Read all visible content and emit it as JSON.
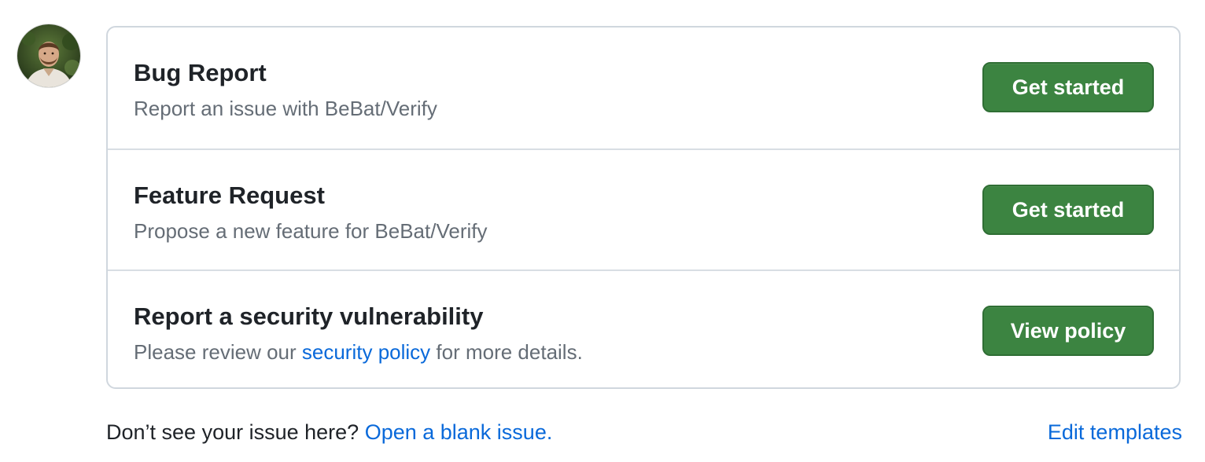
{
  "templates": [
    {
      "title": "Bug Report",
      "description": "Report an issue with BeBat/Verify",
      "button_label": "Get started"
    },
    {
      "title": "Feature Request",
      "description": "Propose a new feature for BeBat/Verify",
      "button_label": "Get started"
    },
    {
      "title": "Report a security vulnerability",
      "description_before": "Please review our ",
      "description_link": "security policy",
      "description_after": " for more details.",
      "button_label": "View policy"
    }
  ],
  "footer": {
    "prompt": "Don’t see your issue here? ",
    "blank_issue_link": "Open a blank issue.",
    "edit_templates_link": "Edit templates"
  },
  "colors": {
    "primary_button": "#3c8441",
    "link": "#0969da",
    "border": "#d0d7de",
    "muted_text": "#656d76"
  },
  "icons": {
    "avatar": "user-avatar-photo"
  }
}
